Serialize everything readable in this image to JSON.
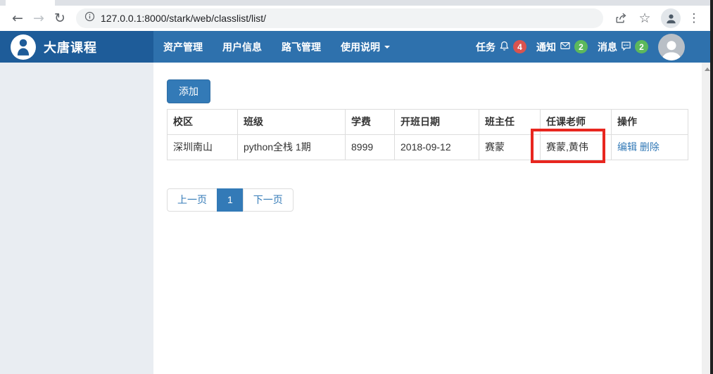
{
  "browser": {
    "url": "127.0.0.1:8000/stark/web/classlist/list/"
  },
  "navbar": {
    "brand": "大唐课程",
    "items": [
      {
        "label": "资产管理"
      },
      {
        "label": "用户信息"
      },
      {
        "label": "路飞管理"
      },
      {
        "label": "使用说明"
      }
    ],
    "status": [
      {
        "label": "任务",
        "icon": "bell-icon",
        "count": "4",
        "badge_color": "#d9534f"
      },
      {
        "label": "通知",
        "icon": "envelope-icon",
        "count": "2",
        "badge_color": "#5cb85c"
      },
      {
        "label": "消息",
        "icon": "comment-icon",
        "count": "2",
        "badge_color": "#5cb85c"
      }
    ]
  },
  "main": {
    "add_button_label": "添加",
    "table": {
      "headers": [
        "校区",
        "班级",
        "学费",
        "开班日期",
        "班主任",
        "任课老师",
        "操作"
      ],
      "rows": [
        {
          "campus": "深圳南山",
          "class_name": "python全栈 1期",
          "tuition": "8999",
          "start_date": "2018-09-12",
          "head_teacher": "赛蒙",
          "teachers": "赛蒙,黄伟",
          "actions": [
            {
              "label": "编辑"
            },
            {
              "label": "删除"
            }
          ]
        }
      ]
    },
    "pagination": {
      "prev": "上一页",
      "current": "1",
      "next": "下一页"
    },
    "annotation": {
      "type": "red-box",
      "target": "teachers-cell",
      "color": "#e8261f"
    }
  },
  "colors": {
    "brand_bg": "#1e5c99",
    "navbar_bg": "#2e71ad",
    "primary": "#337ab7",
    "badge_red": "#d9534f",
    "badge_green": "#5cb85c",
    "sidebar_bg": "#e9edf2",
    "annotation_red": "#e8261f"
  }
}
